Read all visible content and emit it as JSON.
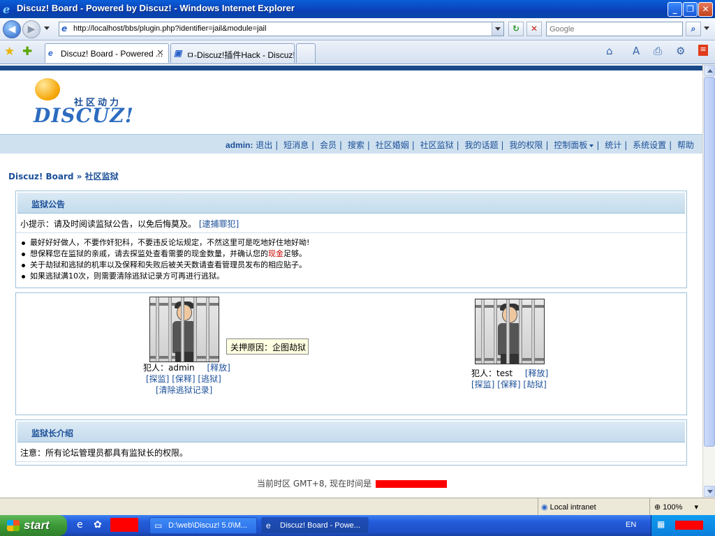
{
  "window": {
    "title": "Discuz! Board - Powered by Discuz! - Windows Internet Explorer"
  },
  "browser": {
    "url": "http://localhost/bbs/plugin.php?identifier=jail&module=jail",
    "search_placeholder": "Google",
    "tabs": [
      {
        "label": "Discuz! Board - Powered ..."
      },
      {
        "label": "ㅁ-Discuz!插件Hack - Discuz! ..."
      }
    ]
  },
  "site": {
    "tagline": "社区动力",
    "brand": "DISCUZ!",
    "user": "admin:",
    "nav": [
      "退出",
      "短消息",
      "会员",
      "搜索",
      "社区婚姻",
      "社区监狱",
      "我的话题",
      "我的权限",
      "控制面板",
      "统计",
      "系统设置",
      "帮助"
    ],
    "breadcrumb": "Discuz! Board » 社区监狱"
  },
  "announcement": {
    "title": "监狱公告",
    "tip_prefix": "小提示：请及时阅读监狱公告，以免后悔莫及。",
    "tip_link": "[逮捕罪犯]",
    "rules": [
      {
        "text": "最好好好做人，不要作奸犯科，不要违反论坛规定，不然这里可是吃地好住地好呦!"
      },
      {
        "pre": "想保释您在监狱的亲戚，请去探监处查看需要的现金数量，并确认您的",
        "red": "现金",
        "post": "足够。"
      },
      {
        "text": "关于劫狱和逃狱的机率以及保释和失败后被关天数请查看管理员发布的相应贴子。"
      },
      {
        "text": "如果逃狱满10次，则需要清除逃狱记录方可再进行逃狱。"
      }
    ]
  },
  "prisoners": [
    {
      "label": "犯人：admin",
      "release": "[释放]",
      "actions": [
        "[探监]",
        "[保释]",
        "[逃狱]"
      ],
      "extra": "[清除逃狱记录]",
      "tooltip": "关押原因：企图劫狱"
    },
    {
      "label": "犯人：test",
      "release": "[释放]",
      "actions": [
        "[探监]",
        "[保释]",
        "[劫狱]"
      ]
    }
  ],
  "warden": {
    "title": "监狱长介绍",
    "note": "注意：所有论坛管理员都具有监狱长的权限。"
  },
  "footer": {
    "time_text": "当前时区 GMT+8, 现在时间是"
  },
  "status": {
    "zone": "Local intranet",
    "zoom": "100%"
  },
  "taskbar": {
    "start": "start",
    "tasks": [
      {
        "label": "D:\\web\\Discuz! 5.0\\M..."
      },
      {
        "label": "Discuz! Board - Powe..."
      }
    ],
    "lang": "EN"
  }
}
